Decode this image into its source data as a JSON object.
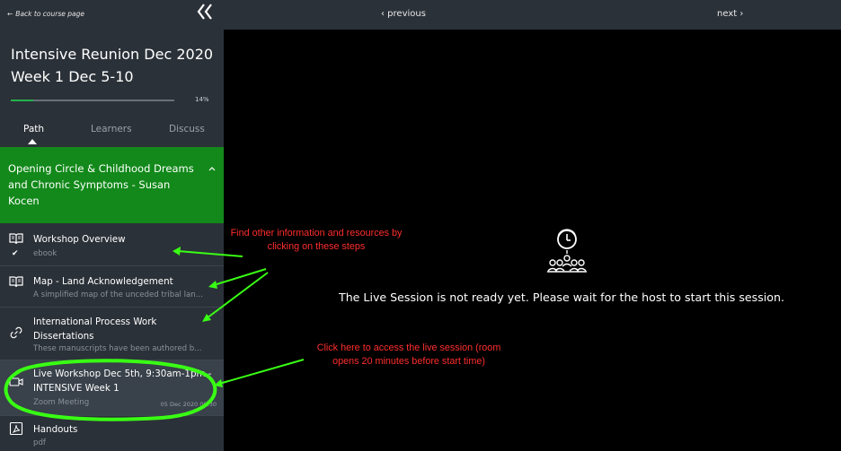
{
  "sidebar": {
    "back_label": "Back to course page",
    "course_title": "Intensive Reunion Dec 2020 Week 1 Dec 5-10",
    "progress_label": "14%",
    "progress_fraction": 0.14,
    "tabs": [
      {
        "label": "Path",
        "active": true
      },
      {
        "label": "Learners",
        "active": false
      },
      {
        "label": "Discuss",
        "active": false
      }
    ],
    "section_title": "Opening Circle & Childhood Dreams and Chronic Symptoms - Susan Kocen",
    "items": [
      {
        "icon": "book-icon",
        "title": "Workshop Overview",
        "subtitle": "ebook",
        "completed": true
      },
      {
        "icon": "book-icon",
        "title": "Map - Land Acknowledgement",
        "subtitle": "A simplified map of the unceded tribal lan..."
      },
      {
        "icon": "link-icon",
        "title": "International Process Work Dissertations",
        "subtitle": "These manuscripts have been authored b..."
      },
      {
        "icon": "video-icon",
        "title": "Live Workshop Dec 5th, 9:30am-1pm - INTENSIVE Week 1",
        "subtitle": "Zoom Meeting",
        "date": "05 Dec 2020 09:30"
      },
      {
        "icon": "pdf-icon",
        "title": "Handouts",
        "subtitle": "pdf"
      }
    ]
  },
  "main": {
    "prev_label": "‹ previous",
    "next_label": "next ›",
    "live_message": "The Live Session is not ready yet. Please wait for the host to start this session."
  },
  "annotations": {
    "steps_note": "Find other information and resources by clicking on these steps",
    "live_note": "Click here to access the live session (room opens 20 minutes before start time)"
  },
  "colors": {
    "sidebar_bg": "#2b3138",
    "section_green": "#12891a",
    "progress_green": "#24b24b",
    "annotation_red": "#ff2d2d",
    "highlight_green": "#39ff14"
  }
}
